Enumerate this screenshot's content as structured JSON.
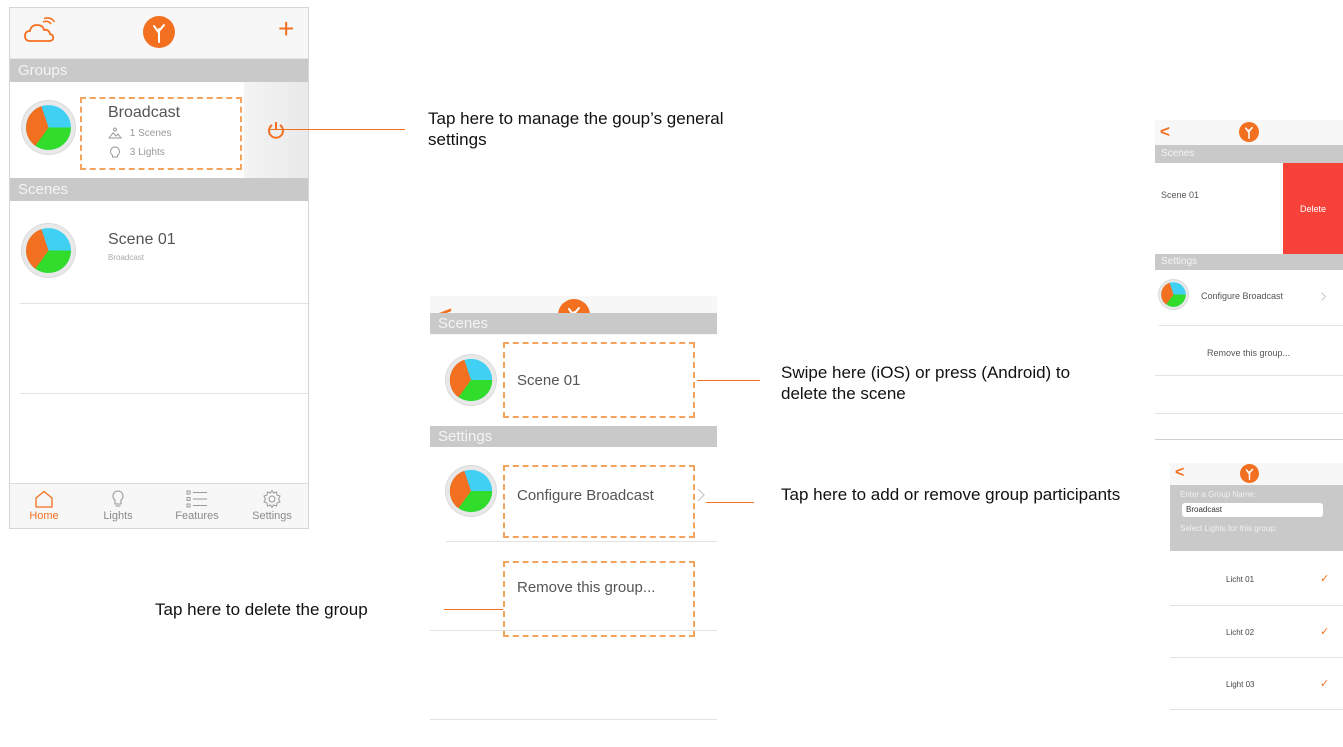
{
  "colors": {
    "accent": "#f37021",
    "section": "#c9c9c9",
    "delete": "#f7423a"
  },
  "phone1": {
    "icons": {
      "left": "cloud-icon",
      "center": "logo-icon",
      "right": "plus-icon"
    },
    "add_label": "+",
    "groups_header": "Groups",
    "group": {
      "name": "Broadcast",
      "scenes": "1 Scenes",
      "lights": "3 Lights"
    },
    "scenes_header": "Scenes",
    "scene": {
      "name": "Scene 01",
      "subtitle": "Broadcast"
    },
    "tabs": [
      {
        "label": "Home",
        "icon": "home-icon",
        "active": true
      },
      {
        "label": "Lights",
        "icon": "bulb-icon",
        "active": false
      },
      {
        "label": "Features",
        "icon": "list-icon",
        "active": false
      },
      {
        "label": "Settings",
        "icon": "gear-icon",
        "active": false
      }
    ]
  },
  "phone2": {
    "back": "<",
    "scenes_header": "Scenes",
    "scene_name": "Scene 01",
    "settings_header": "Settings",
    "configure_label": "Configure Broadcast",
    "remove_label": "Remove this group..."
  },
  "phone3": {
    "back": "<",
    "scenes_header": "Scenes",
    "scene_name": "Scene 01",
    "delete_label": "Delete",
    "settings_header": "Settings",
    "configure_label": "Configure Broadcast",
    "remove_label": "Remove this group..."
  },
  "phone4": {
    "back": "<",
    "name_prompt": "Enter a Group Name:",
    "name_value": "Broadcast",
    "lights_prompt": "Select Lights for this group:",
    "lights": [
      "Licht 01",
      "Licht 02",
      "Light 03"
    ],
    "check": "✓"
  },
  "callouts": {
    "manage": "Tap here to manage the goup’s general settings",
    "swipe": "Swipe here (iOS) or press (Android) to delete the scene",
    "participants": "Tap here to add or remove group participants",
    "delete_group": "Tap here to delete the group"
  }
}
